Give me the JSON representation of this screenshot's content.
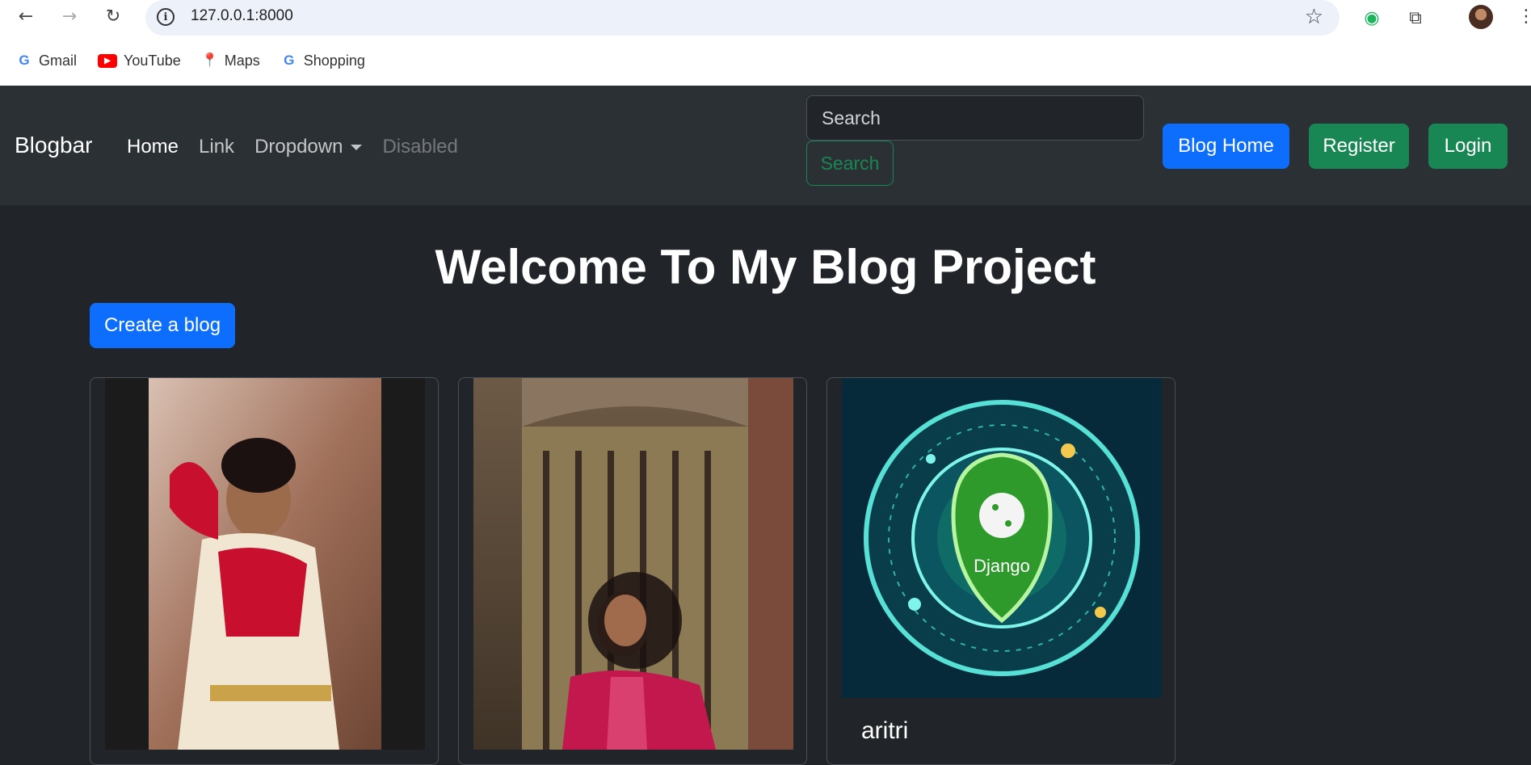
{
  "browser": {
    "url": "127.0.0.1:8000",
    "bookmarks": [
      {
        "label": "Gmail",
        "icon": "google-icon"
      },
      {
        "label": "YouTube",
        "icon": "youtube-icon"
      },
      {
        "label": "Maps",
        "icon": "maps-icon"
      },
      {
        "label": "Shopping",
        "icon": "google-icon"
      }
    ]
  },
  "navbar": {
    "brand": "Blogbar",
    "links": [
      "Home",
      "Link",
      "Dropdown",
      "Disabled"
    ],
    "search_placeholder": "Search",
    "search_button": "Search",
    "blog_home": "Blog Home",
    "register": "Register",
    "login": "Login"
  },
  "main": {
    "heading": "Welcome To My Blog Project",
    "create_button": "Create a blog",
    "cards": [
      {
        "title": ""
      },
      {
        "title": ""
      },
      {
        "title": "aritri",
        "image_text": "Django"
      }
    ]
  },
  "colors": {
    "primary": "#0d6efd",
    "success": "#198754",
    "navbar": "#2b3035",
    "body": "#212529"
  }
}
